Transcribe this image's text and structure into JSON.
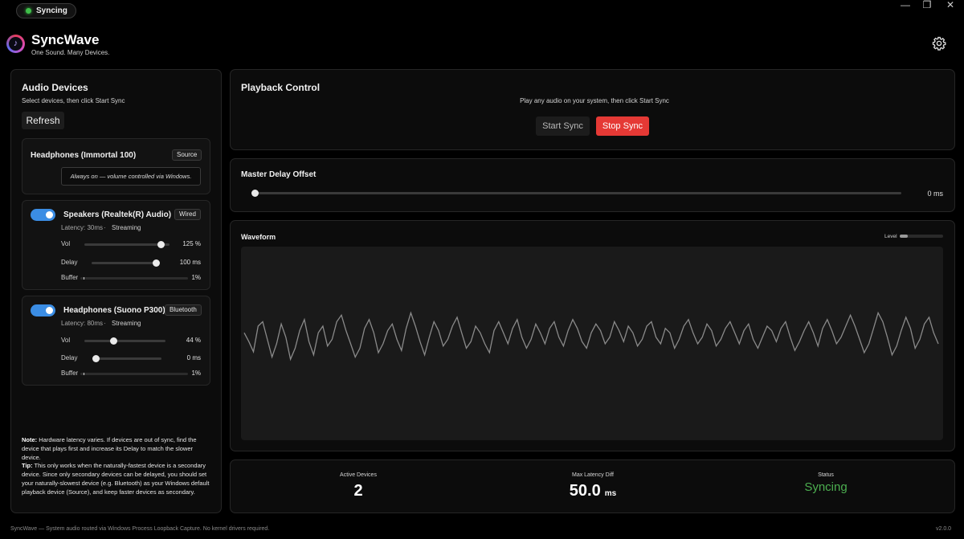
{
  "status_pill": {
    "label": "Syncing",
    "dot_color": "#3fbf4a"
  },
  "window_controls": {
    "minimize": "—",
    "maximize": "❐",
    "close": "✕"
  },
  "app": {
    "title": "SyncWave",
    "subtitle": "One Sound. Many Devices.",
    "logo_glyph": "♪",
    "settings_icon": "gear-icon"
  },
  "audio_devices": {
    "title": "Audio Devices",
    "subtitle": "Select devices, then click Start Sync",
    "refresh_label": "Refresh",
    "source_device": {
      "name": "Headphones (Immortal 100)",
      "tag": "Source",
      "info": "Always on — volume controlled via Windows."
    },
    "devices": [
      {
        "name": "Speakers (Realtek(R) Audio)",
        "tag": "Wired",
        "enabled": true,
        "latency": "Latency: 30ms",
        "separator": "·",
        "state": "Streaming",
        "vol_label": "Vol",
        "vol_value": "125 %",
        "vol_level": 0.9,
        "delay_label": "Delay",
        "delay_value": "100 ms",
        "delay_level": 0.97,
        "buffer_label": "Buffer",
        "buffer_value": "1%",
        "buffer_level": 0.01
      },
      {
        "name": "Headphones (Suono P300)",
        "tag": "Bluetooth",
        "enabled": true,
        "latency": "Latency: 80ms",
        "separator": "·",
        "state": "Streaming",
        "vol_label": "Vol",
        "vol_value": "44 %",
        "vol_level": 0.36,
        "delay_label": "Delay",
        "delay_value": "0 ms",
        "delay_level": 0.0,
        "buffer_label": "Buffer",
        "buffer_value": "1%",
        "buffer_level": 0.01
      }
    ],
    "note_label": "Note:",
    "note_text": " Hardware latency varies. If devices are out of sync, find the device that plays first and increase its Delay to match the slower device.",
    "tip_label": "Tip:",
    "tip_text": " This only works when the naturally-fastest device is a secondary device. Since only secondary devices can be delayed, you should set your naturally-slowest device (e.g. Bluetooth) as your Windows default playback device (Source), and keep faster devices as secondary."
  },
  "playback": {
    "title": "Playback Control",
    "hint": "Play any audio on your system, then click Start Sync",
    "start_label": "Start Sync",
    "stop_label": "Stop Sync",
    "stop_color": "#e53935"
  },
  "master_delay": {
    "title": "Master Delay Offset",
    "value": "0 ms",
    "level": 0.0
  },
  "waveform": {
    "title": "Waveform",
    "level_label": "Level",
    "level": 0.18,
    "samples": [
      0.05,
      -0.15,
      -0.38,
      0.2,
      0.3,
      -0.1,
      -0.5,
      -0.2,
      0.25,
      -0.05,
      -0.55,
      -0.3,
      0.1,
      0.35,
      -0.15,
      -0.45,
      0.05,
      0.2,
      -0.25,
      -0.1,
      0.3,
      0.45,
      0.1,
      -0.2,
      -0.5,
      -0.3,
      0.15,
      0.35,
      0.05,
      -0.4,
      -0.2,
      0.1,
      0.25,
      -0.1,
      -0.35,
      0.15,
      0.5,
      0.2,
      -0.15,
      -0.45,
      -0.05,
      0.3,
      0.1,
      -0.25,
      -0.1,
      0.2,
      0.4,
      0.05,
      -0.3,
      -0.15,
      0.2,
      0.05,
      -0.2,
      -0.4,
      0.1,
      0.3,
      0.05,
      -0.2,
      0.15,
      0.35,
      -0.05,
      -0.3,
      -0.1,
      0.25,
      0.05,
      -0.2,
      0.15,
      0.3,
      -0.05,
      -0.25,
      0.1,
      0.35,
      0.15,
      -0.15,
      -0.3,
      0.05,
      0.25,
      0.1,
      -0.2,
      -0.05,
      0.3,
      0.1,
      -0.15,
      0.2,
      0.05,
      -0.25,
      -0.1,
      0.2,
      0.3,
      -0.05,
      -0.2,
      0.15,
      0.05,
      -0.3,
      -0.1,
      0.2,
      0.35,
      0.05,
      -0.2,
      -0.05,
      0.25,
      0.1,
      -0.25,
      -0.1,
      0.15,
      0.3,
      0.05,
      -0.2,
      0.1,
      0.25,
      -0.1,
      -0.3,
      -0.05,
      0.2,
      0.1,
      -0.15,
      0.15,
      0.3,
      -0.05,
      -0.35,
      -0.15,
      0.1,
      0.3,
      0.05,
      -0.25,
      0.15,
      0.35,
      0.1,
      -0.2,
      -0.05,
      0.2,
      0.45,
      0.2,
      -0.1,
      -0.4,
      -0.2,
      0.15,
      0.5,
      0.3,
      -0.05,
      -0.45,
      -0.25,
      0.1,
      0.4,
      0.15,
      -0.3,
      -0.1,
      0.25,
      0.4,
      0.05,
      -0.2
    ]
  },
  "stats": {
    "active_label": "Active Devices",
    "active_value": "2",
    "latency_label": "Max Latency Diff",
    "latency_value": "50.0",
    "latency_unit": "ms",
    "status_label": "Status",
    "status_value": "Syncing",
    "status_color": "#4caf50"
  },
  "footer": {
    "left": "SyncWave  — System audio routed via Windows Process Loopback Capture. No kernel drivers required.",
    "version": "v2.0.0"
  }
}
